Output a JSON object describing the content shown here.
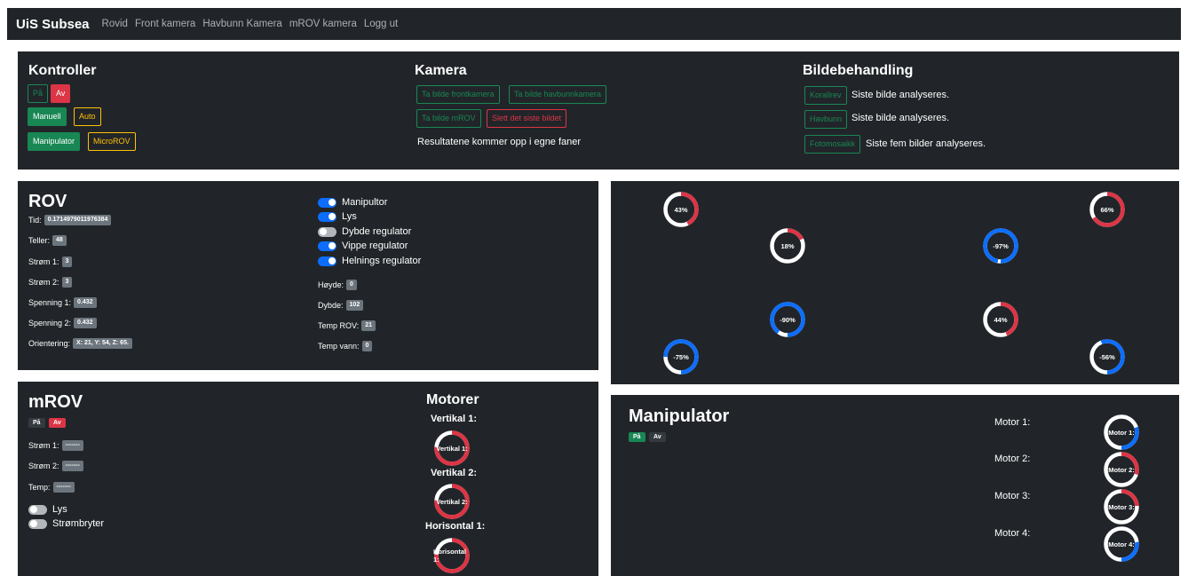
{
  "nav": {
    "brand": "UiS Subsea",
    "links": [
      "Rovid",
      "Front kamera",
      "Havbunn Kamera",
      "mROV kamera",
      "Logg ut"
    ]
  },
  "kontroller": {
    "title": "Kontroller",
    "paa": "På",
    "av": "Av",
    "manuell": "Manuell",
    "auto": "Auto",
    "manipulator": "Manipulator",
    "microrov": "MicroROV"
  },
  "kamera": {
    "title": "Kamera",
    "btn_front": "Ta bilde frontkamera",
    "btn_havbunn": "Ta bilde havbunnkamera",
    "btn_mrov": "Ta bilde mROV",
    "btn_slett": "Slett det siste bildet",
    "note": "Resultatene kommer opp i egne faner"
  },
  "bilde": {
    "title": "Bildebehandling",
    "rows": [
      {
        "btn": "Korallrev",
        "text": "Siste bilde analyseres."
      },
      {
        "btn": "Havbunn",
        "text": "Siste bilde analyseres."
      },
      {
        "btn": "Fotomosaikk",
        "text": "Siste fem bilder analyseres."
      }
    ]
  },
  "rov": {
    "title": "ROV",
    "left": [
      {
        "label": "Tid:",
        "value": "0.1714979011976384"
      },
      {
        "label": "Teller:",
        "value": "48"
      },
      {
        "label": "Strøm 1:",
        "value": "3"
      },
      {
        "label": "Strøm 2:",
        "value": "3"
      },
      {
        "label": "Spenning 1:",
        "value": "0.432"
      },
      {
        "label": "Spenning 2:",
        "value": "0.432"
      },
      {
        "label": "Orientering:",
        "value": "X: 21, Y: 54, Z: 65."
      }
    ],
    "switches": [
      {
        "label": "Manipultor",
        "on": true
      },
      {
        "label": "Lys",
        "on": true
      },
      {
        "label": "Dybde regulator",
        "on": false
      },
      {
        "label": "Vippe regulator",
        "on": true
      },
      {
        "label": "Helnings regulator",
        "on": true
      }
    ],
    "right": [
      {
        "label": "Høyde:",
        "value": "0"
      },
      {
        "label": "Dybde:",
        "value": "102"
      },
      {
        "label": "Temp ROV:",
        "value": "21"
      },
      {
        "label": "Temp vann:",
        "value": "0"
      }
    ]
  },
  "thrusters": [
    {
      "value": 43,
      "label": "43%"
    },
    {
      "value": 66,
      "label": "66%"
    },
    {
      "value": 18,
      "label": "18%"
    },
    {
      "value": -97,
      "label": "-97%"
    },
    {
      "value": -90,
      "label": "-90%"
    },
    {
      "value": 44,
      "label": "44%"
    },
    {
      "value": -75,
      "label": "-75%"
    },
    {
      "value": -56,
      "label": "-56%"
    }
  ],
  "mrov": {
    "title": "mROV",
    "paa": "På",
    "av": "Av",
    "rows": [
      {
        "label": "Strøm 1:",
        "value": "-------"
      },
      {
        "label": "Strøm 2:",
        "value": "-------"
      },
      {
        "label": "Temp:",
        "value": "-------"
      }
    ],
    "switches": [
      {
        "label": "Lys",
        "on": false
      },
      {
        "label": "Strømbryter",
        "on": false
      }
    ]
  },
  "motorer": {
    "title": "Motorer",
    "items": [
      {
        "label": "Vertikal 1:",
        "value": 76,
        "text": "76%"
      },
      {
        "label": "Vertikal 2:",
        "value": 76,
        "text": "76%"
      },
      {
        "label": "Horisontal 1:",
        "value": 76,
        "text": "76%"
      }
    ]
  },
  "manipulator": {
    "title": "Manipulator",
    "paa": "På",
    "av": "Av",
    "motors": [
      {
        "label": "Motor 1:",
        "value": -30,
        "text": "-30%"
      },
      {
        "label": "Motor 2:",
        "value": 30,
        "text": "30%"
      },
      {
        "label": "Motor 3:",
        "value": 24,
        "text": "24%"
      },
      {
        "label": "Motor 4:",
        "value": -27,
        "text": "-27%"
      }
    ]
  },
  "colors": {
    "positive": "#dc3545",
    "negative": "#0d6efd",
    "track": "#ffffff",
    "green": "#198754",
    "yellow": "#ffc107",
    "panel": "#212529"
  }
}
